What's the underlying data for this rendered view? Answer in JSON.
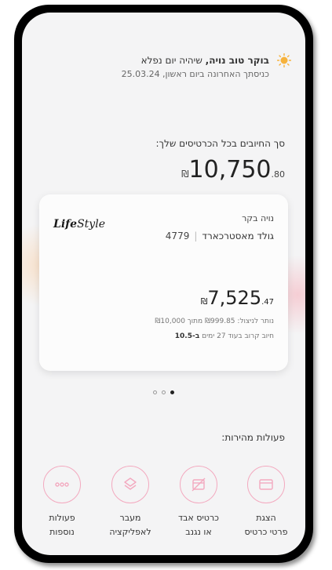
{
  "greeting": {
    "line1_bold": "בוקר טוב נויה,",
    "line1_rest": "שיהיה יום נפלא",
    "line2": "כניסתך האחרונה ביום ראשון, 25.03.24"
  },
  "total": {
    "label": "סך החיובים בכל הכרטיסים שלך:",
    "currency": "₪",
    "integer": "10,750",
    "decimal": ".80"
  },
  "card": {
    "logo_bold": "Life",
    "logo_script": "Style",
    "owner": "נויה בקר",
    "type": "גולד מאסטרכארד",
    "last_digits": "4779",
    "balance_currency": "₪",
    "balance_integer": "7,525",
    "balance_decimal": ".47",
    "line1": "נותר לניצול: ₪999.85 מתוך ₪10,000",
    "line2_prefix": "חיוב קרוב בעוד 27 ימים",
    "line2_bold": "ב-10.5"
  },
  "pagination": {
    "count": 3,
    "active": 3
  },
  "quick_actions": {
    "title": "פעולות מהירות:",
    "items": [
      {
        "line1": "פעולות",
        "line2": "נוספות",
        "icon": "more-dots-icon"
      },
      {
        "line1": "מעבר",
        "line2": "לאפליקציה",
        "icon": "app-switch-icon"
      },
      {
        "line1": "כרטיס אבד",
        "line2": "או נגנב",
        "icon": "card-lost-icon"
      },
      {
        "line1": "הצגת",
        "line2": "פרטי כרטיס",
        "icon": "card-details-icon"
      }
    ]
  },
  "colors": {
    "accent_pink": "#f3a9bf",
    "sun": "#f6b23c"
  }
}
